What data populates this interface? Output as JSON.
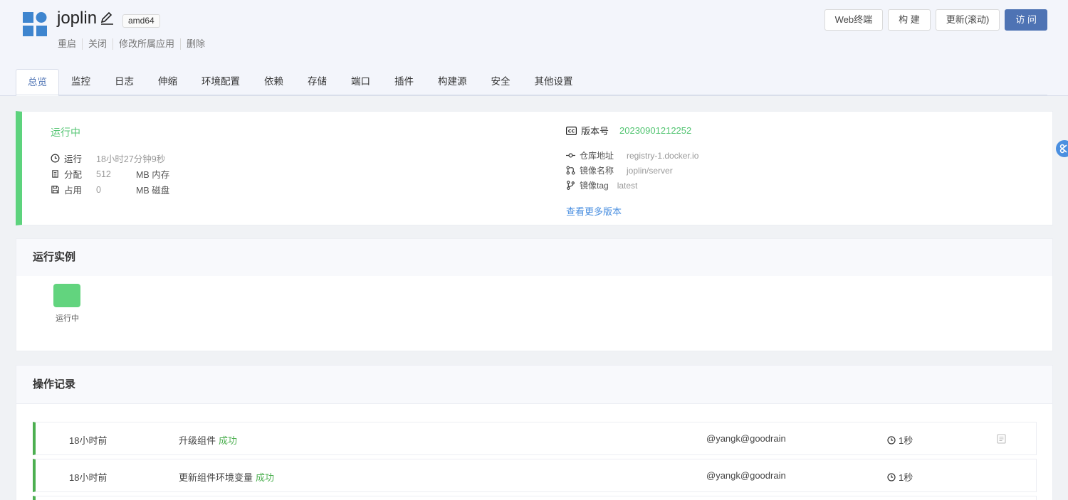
{
  "app": {
    "name": "joplin",
    "arch": "amd64",
    "actions": [
      "重启",
      "关闭",
      "修改所属应用",
      "删除"
    ]
  },
  "top_buttons": {
    "web_terminal": "Web终端",
    "build": "构 建",
    "update": "更新(滚动)",
    "visit": "访 问"
  },
  "tabs": [
    "总览",
    "监控",
    "日志",
    "伸缩",
    "环境配置",
    "依赖",
    "存储",
    "端口",
    "插件",
    "构建源",
    "安全",
    "其他设置"
  ],
  "status": {
    "state": "运行中",
    "running_label": "运行",
    "running_value": "18小时27分钟9秒",
    "alloc_label": "分配",
    "alloc_value": "512",
    "alloc_unit": "MB 内存",
    "disk_label": "占用",
    "disk_value": "0",
    "disk_unit": "MB 磁盘"
  },
  "version": {
    "label": "版本号",
    "value": "20230901212252",
    "repo_label": "仓库地址",
    "repo_value": "registry-1.docker.io",
    "image_label": "镜像名称",
    "image_value": "joplin/server",
    "tag_label": "镜像tag",
    "tag_value": "latest",
    "more_link": "查看更多版本"
  },
  "instances": {
    "title": "运行实例",
    "items": [
      {
        "label": "运行中",
        "color": "#62d47e"
      }
    ]
  },
  "operations": {
    "title": "操作记录",
    "rows": [
      {
        "time": "18小时前",
        "desc": "升级组件",
        "status": "成功",
        "user": "@yangk@goodrain",
        "duration": "1秒"
      },
      {
        "time": "18小时前",
        "desc": "更新组件环境变量",
        "status": "成功",
        "user": "@yangk@goodrain",
        "duration": "1秒"
      }
    ]
  },
  "colors": {
    "accent": "#4e73b4",
    "success": "#52c471",
    "link": "#4a8fe0"
  }
}
